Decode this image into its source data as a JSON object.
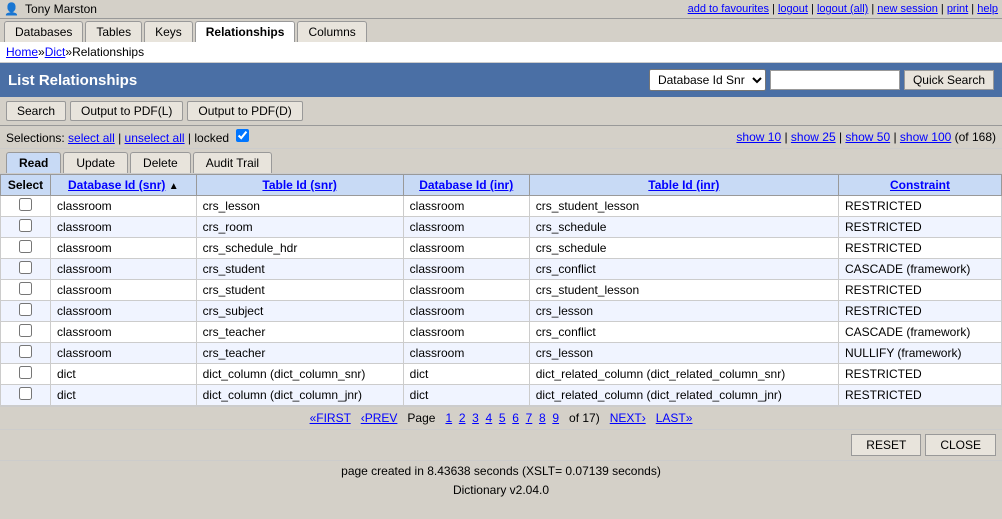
{
  "topbar": {
    "user": "Tony Marston",
    "links": [
      "add to favourites",
      "logout",
      "logout (all)",
      "new session",
      "print",
      "help"
    ]
  },
  "nav": {
    "tabs": [
      "Databases",
      "Tables",
      "Keys",
      "Relationships",
      "Columns"
    ],
    "active": "Relationships"
  },
  "breadcrumb": {
    "parts": [
      "Home",
      "Dict",
      "Relationships"
    ],
    "separator": "»"
  },
  "list": {
    "title": "List Relationships",
    "db_select_label": "Database Id Snr",
    "search_placeholder": "",
    "quick_search_label": "Quick Search"
  },
  "action_buttons": {
    "search": "Search",
    "output_pdf_l": "Output to PDF(L)",
    "output_pdf_d": "Output to PDF(D)"
  },
  "selections": {
    "label": "Selections:",
    "select_all": "select all",
    "unselect_all": "unselect all",
    "locked": "locked",
    "show_10": "show 10",
    "show_25": "show 25",
    "show_50": "show 50",
    "show_100": "show 100",
    "total": "(of 168)"
  },
  "crud_tabs": [
    "Read",
    "Update",
    "Delete",
    "Audit Trail"
  ],
  "active_crud": "Read",
  "columns": [
    {
      "key": "select",
      "label": "Select"
    },
    {
      "key": "db_id_snr",
      "label": "Database Id (snr)"
    },
    {
      "key": "table_id_snr",
      "label": "Table Id (snr)"
    },
    {
      "key": "db_id_inr",
      "label": "Database Id (inr)"
    },
    {
      "key": "table_id_inr",
      "label": "Table Id (inr)"
    },
    {
      "key": "constraint",
      "label": "Constraint"
    }
  ],
  "rows": [
    {
      "db_id_snr": "classroom",
      "table_id_snr": "crs_lesson",
      "db_id_inr": "classroom",
      "table_id_inr": "crs_student_lesson",
      "constraint": "RESTRICTED"
    },
    {
      "db_id_snr": "classroom",
      "table_id_snr": "crs_room",
      "db_id_inr": "classroom",
      "table_id_inr": "crs_schedule",
      "constraint": "RESTRICTED"
    },
    {
      "db_id_snr": "classroom",
      "table_id_snr": "crs_schedule_hdr",
      "db_id_inr": "classroom",
      "table_id_inr": "crs_schedule",
      "constraint": "RESTRICTED"
    },
    {
      "db_id_snr": "classroom",
      "table_id_snr": "crs_student",
      "db_id_inr": "classroom",
      "table_id_inr": "crs_conflict",
      "constraint": "CASCADE (framework)"
    },
    {
      "db_id_snr": "classroom",
      "table_id_snr": "crs_student",
      "db_id_inr": "classroom",
      "table_id_inr": "crs_student_lesson",
      "constraint": "RESTRICTED"
    },
    {
      "db_id_snr": "classroom",
      "table_id_snr": "crs_subject",
      "db_id_inr": "classroom",
      "table_id_inr": "crs_lesson",
      "constraint": "RESTRICTED"
    },
    {
      "db_id_snr": "classroom",
      "table_id_snr": "crs_teacher",
      "db_id_inr": "classroom",
      "table_id_inr": "crs_conflict",
      "constraint": "CASCADE (framework)"
    },
    {
      "db_id_snr": "classroom",
      "table_id_snr": "crs_teacher",
      "db_id_inr": "classroom",
      "table_id_inr": "crs_lesson",
      "constraint": "NULLIFY (framework)"
    },
    {
      "db_id_snr": "dict",
      "table_id_snr": "dict_column (dict_column_snr)",
      "db_id_inr": "dict",
      "table_id_inr": "dict_related_column (dict_related_column_snr)",
      "constraint": "RESTRICTED"
    },
    {
      "db_id_snr": "dict",
      "table_id_snr": "dict_column (dict_column_jnr)",
      "db_id_inr": "dict",
      "table_id_inr": "dict_related_column (dict_related_column_jnr)",
      "constraint": "RESTRICTED"
    }
  ],
  "pagination": {
    "first": "«FIRST",
    "prev": "‹PREV",
    "page_label": "Page",
    "pages": [
      "1",
      "2",
      "3",
      "4",
      "5",
      "6",
      "7",
      "8",
      "9"
    ],
    "of": "of 17)",
    "next": "NEXT›",
    "last": "LAST»",
    "current_page": "1",
    "paren_open": "("
  },
  "bottom_buttons": {
    "reset": "RESET",
    "close": "CLOSE"
  },
  "footer": {
    "timing": "page created in 8.43638 seconds (XSLT= 0.07139 seconds)",
    "version": "Dictionary v2.04.0"
  }
}
